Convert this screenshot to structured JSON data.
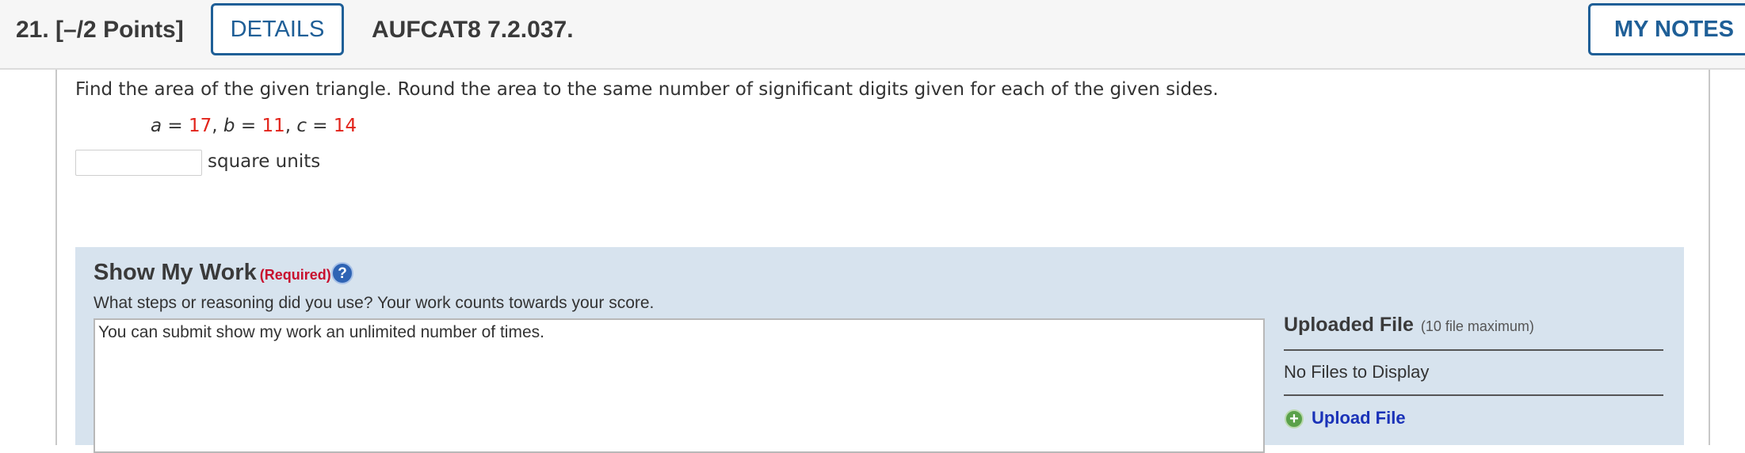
{
  "header": {
    "question_label": "21.  [–/2 Points]",
    "details_button": "DETAILS",
    "problem_code": "AUFCAT8 7.2.037.",
    "notes_button": "MY NOTES"
  },
  "question": {
    "prompt": "Find the area of the given triangle. Round the area to the same number of significant digits given for each of the given sides.",
    "sides": [
      {
        "var": "a",
        "value": "17"
      },
      {
        "var": "b",
        "value": "11"
      },
      {
        "var": "c",
        "value": "14"
      }
    ],
    "answer_value": "",
    "units": "square units"
  },
  "show_my_work": {
    "title": "Show My Work",
    "required": "(Required)",
    "help_glyph": "?",
    "subtitle": "What steps or reasoning did you use? Your work counts towards your score.",
    "textbox_value": "You can submit show my work an unlimited number of times.",
    "uploaded_title": "Uploaded File",
    "uploaded_max": "(10 file maximum)",
    "no_files": "No Files to Display",
    "upload_label": "Upload File"
  },
  "colors": {
    "accent_blue": "#1f5f97",
    "value_red": "#e2231a",
    "required_red": "#c8102e",
    "show_work_bg": "#d7e3ee",
    "link_blue": "#1a32b8"
  },
  "icons": [
    "help-icon",
    "plus-circle-icon"
  ]
}
